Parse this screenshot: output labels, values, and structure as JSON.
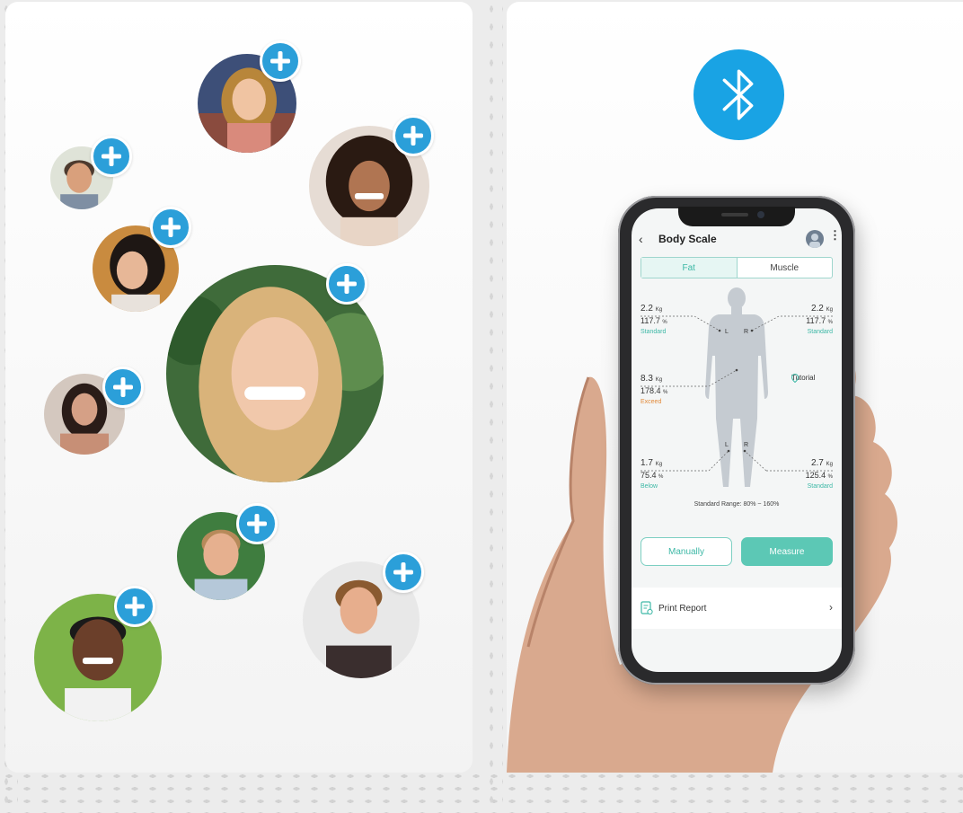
{
  "colors": {
    "accent": "#2b9fd9",
    "bluetooth": "#19a3e4",
    "teal": "#5cc8b5",
    "teal_text": "#3db8a6",
    "exceed": "#e28a3b"
  },
  "profiles": [
    {
      "name": "profile-1",
      "icon": "plus-icon"
    },
    {
      "name": "profile-2",
      "icon": "plus-icon"
    },
    {
      "name": "profile-3",
      "icon": "plus-icon"
    },
    {
      "name": "profile-4",
      "icon": "plus-icon"
    },
    {
      "name": "profile-5",
      "icon": "plus-icon"
    },
    {
      "name": "profile-6",
      "icon": "plus-icon"
    },
    {
      "name": "profile-7",
      "icon": "plus-icon"
    },
    {
      "name": "profile-8",
      "icon": "plus-icon"
    },
    {
      "name": "profile-9",
      "icon": "plus-icon"
    }
  ],
  "bluetooth_icon": "bluetooth-icon",
  "app": {
    "title": "Body Scale",
    "tabs": [
      "Fat",
      "Muscle"
    ],
    "active_tab": "Fat",
    "metrics": {
      "left_arm": {
        "kg": "2.2",
        "kg_unit": "Kg",
        "pct": "117.7",
        "pct_unit": "%",
        "status": "Standard"
      },
      "right_arm": {
        "kg": "2.2",
        "kg_unit": "Kg",
        "pct": "117.7",
        "pct_unit": "%",
        "status": "Standard"
      },
      "trunk": {
        "kg": "8.3",
        "kg_unit": "Kg",
        "pct": "178.4",
        "pct_unit": "%",
        "status": "Exceed"
      },
      "left_leg": {
        "kg": "1.7",
        "kg_unit": "Kg",
        "pct": "75.4",
        "pct_unit": "%",
        "status": "Below"
      },
      "right_leg": {
        "kg": "2.7",
        "kg_unit": "Kg",
        "pct": "125.4",
        "pct_unit": "%",
        "status": "Standard"
      }
    },
    "side_labels": {
      "left": "L",
      "right": "R"
    },
    "tutorial_label": "Tutorial",
    "standard_range": "Standard Range: 80% ~ 160%",
    "manual_label": "Manually",
    "measure_label": "Measure",
    "print_label": "Print Report"
  }
}
